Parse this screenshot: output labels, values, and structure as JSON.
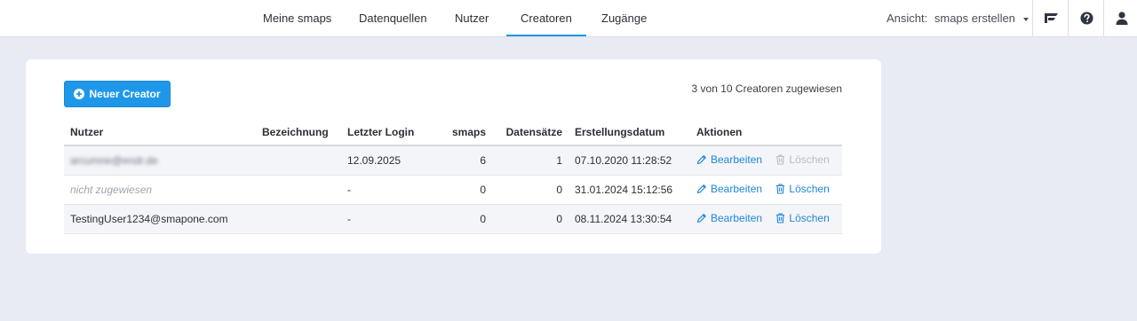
{
  "nav": {
    "items": [
      {
        "label": "Meine smaps",
        "active": false
      },
      {
        "label": "Datenquellen",
        "active": false
      },
      {
        "label": "Nutzer",
        "active": false
      },
      {
        "label": "Creatoren",
        "active": true
      },
      {
        "label": "Zugänge",
        "active": false
      }
    ]
  },
  "header": {
    "view_label": "Ansicht:",
    "view_value": "smaps erstellen",
    "icons": [
      "smapone-logo-icon",
      "help-icon",
      "user-icon"
    ]
  },
  "card": {
    "new_button_label": "Neuer Creator",
    "summary": "3 von 10 Creatoren zugewiesen"
  },
  "table": {
    "columns": [
      "Nutzer",
      "Bezeichnung",
      "Letzter Login",
      "smaps",
      "Datensätze",
      "Erstellungsdatum",
      "Aktionen"
    ],
    "rows": [
      {
        "user": "arcumne@endr.de",
        "user_blurred": true,
        "user_muted": false,
        "designation": "",
        "last_login": "12.09.2025",
        "smaps": "6",
        "records": "1",
        "created": "07.10.2020 11:28:52",
        "edit": "Bearbeiten",
        "delete": "Löschen",
        "delete_enabled": false
      },
      {
        "user": "nicht zugewiesen",
        "user_blurred": false,
        "user_muted": true,
        "designation": "",
        "last_login": "-",
        "smaps": "0",
        "records": "0",
        "created": "31.01.2024 15:12:56",
        "edit": "Bearbeiten",
        "delete": "Löschen",
        "delete_enabled": true
      },
      {
        "user": "TestingUser1234@smapone.com",
        "user_blurred": false,
        "user_muted": false,
        "designation": "",
        "last_login": "-",
        "smaps": "0",
        "records": "0",
        "created": "08.11.2024 13:30:54",
        "edit": "Bearbeiten",
        "delete": "Löschen",
        "delete_enabled": true
      }
    ]
  },
  "colors": {
    "accent": "#1f97e9",
    "link": "#1f86d6",
    "background": "#e8ebf3",
    "disabled": "#b7bcc4"
  }
}
